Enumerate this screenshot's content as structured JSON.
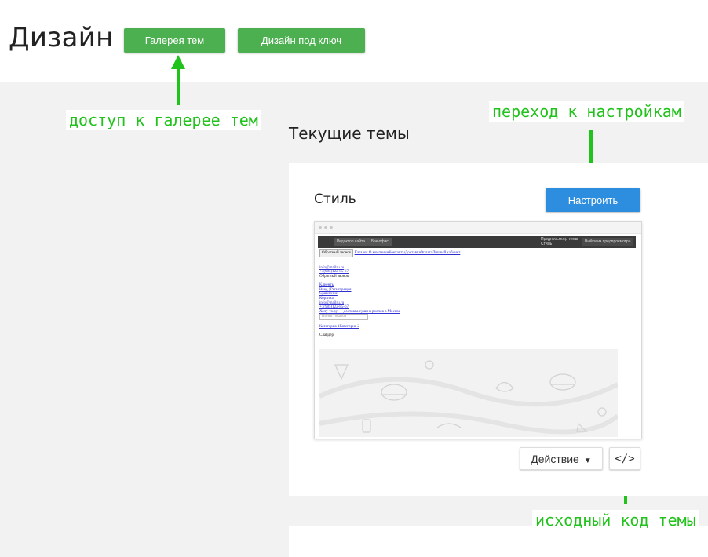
{
  "header": {
    "title": "Дизайн",
    "gallery_button": "Галерея тем",
    "turnkey_button": "Дизайн под ключ"
  },
  "annotations": {
    "gallery": "доступ к галерее тем",
    "settings": "переход к настройкам",
    "source": "исходный код темы",
    "color": "#21c21b"
  },
  "main": {
    "section_title": "Текущие темы",
    "card": {
      "style_label": "Стиль",
      "configure_button": "Настроить",
      "action_button": "Действие",
      "code_button": "</>"
    }
  },
  "preview": {
    "toolbar": {
      "editor": "Редактор сайта",
      "backoffice": "Бэк-офис",
      "preview_title": "Предпросмотр темы",
      "preview_sub": "Стиль",
      "exit": "Выйти из предпросмотра"
    },
    "lines": [
      "Обратный звонок",
      "Каталог О компанииКонтактыДоставкаОплатаЛичный кабинет",
      "info@mailru.ru",
      "+7(985)122-85-67",
      "Обратный звонок",
      "Клиенты",
      "Вход | Регистрация",
      "Сравнение",
      "Корзина",
      "info@mailru.ru",
      "+7(985)122-85-67",
      "Хочу-то.ру — доставка суши и роллов в Москве",
      "Поиск товаров",
      "Категория 1Категория 2",
      "Слайдер"
    ]
  },
  "colors": {
    "green_button": "#4caf50",
    "blue_button": "#2d8edf",
    "background": "#f2f2f2"
  }
}
